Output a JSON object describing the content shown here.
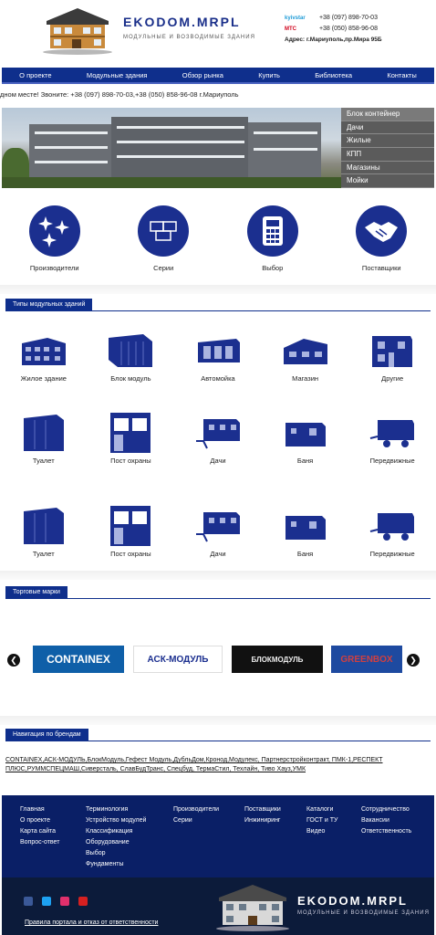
{
  "header": {
    "logo_title": "EKODOM.MRPL",
    "logo_sub": "МОДУЛЬНЫЕ И ВОЗВОДИМЫЕ ЗДАНИЯ",
    "operator1": "kyivstar",
    "phone1": "+38 (097) 898-70-03",
    "operator2": "МТС",
    "phone2": "+38 (050) 858-96-08",
    "address": "Адрес: г.Мариуполь,пр.Мира 95Б"
  },
  "nav": [
    "О проекте",
    "Модульные здания",
    "Обзор рынка",
    "Купить",
    "Библиотека",
    "Контакты"
  ],
  "ticker": "дном месте! Звоните: +38 (097) 898-70-03,+38 (050) 858-96-08 г.Мариуполь",
  "side_menu": [
    "Блок контейнер",
    "Дачи",
    "Жилые",
    "КПП",
    "Магазины",
    "Мойки"
  ],
  "circles": [
    "Производители",
    "Серии",
    "Выбор",
    "Поставщики"
  ],
  "types_title": "Типы модульных зданий",
  "types_row1": [
    "Жилое здание",
    "Блок модуль",
    "Автомойка",
    "Магазин",
    "Другие"
  ],
  "types_row2": [
    "Туалет",
    "Пост охраны",
    "Дачи",
    "Баня",
    "Передвижные"
  ],
  "types_row3": [
    "Туалет",
    "Пост охраны",
    "Дачи",
    "Баня",
    "Передвижные"
  ],
  "brands_title": "Торговые марки",
  "brands": [
    "CONTAINEX",
    "АСК-МОДУЛЬ",
    "БЛОКМОДУЛЬ",
    "GREENBOX"
  ],
  "brand_nav_title": "Навигация по брендам",
  "brand_links": "CONTAINEX,АСК-МОДУЛЬ,БлокМодуль,Гефест Модуль,ДубльДом,Кронод,Модулекс, Партнерстройконтракт, ПМК-1,РЕСПЕКТ ПЛЮС,РУММСПЕЦМАШ,Сиверсталь, СлавБудТранс, Спецбуд, ТермаСтил, Техлайн, Тиво Хауз,УМК",
  "footer": {
    "col1": [
      "Главная",
      "О проекте",
      "Карта сайта",
      "Вопрос-ответ"
    ],
    "col2": [
      "Терминология",
      "Устройство модулей",
      "Классификация",
      "Оборудование",
      "Выбор",
      "Фундаменты"
    ],
    "col3": [
      "Производители",
      "Серии"
    ],
    "col4": [
      "Поставщики",
      "Инжиниринг"
    ],
    "col5": [
      "Каталоги",
      "ГОСТ и ТУ",
      "Видео"
    ],
    "col6": [
      "Сотрудничество",
      "Вакансии",
      "Ответственность"
    ]
  },
  "bottom": {
    "link": "Правила портала и отказ от ответственности",
    "logo_title": "EKODOM.MRPL",
    "logo_sub": "МОДУЛЬНЫЕ И ВОЗВОДИМЫЕ ЗДАНИЯ"
  },
  "colors": {
    "navy": "#0f2f8c",
    "footer": "#0a1f66",
    "bottom": "#0c1b3a"
  }
}
